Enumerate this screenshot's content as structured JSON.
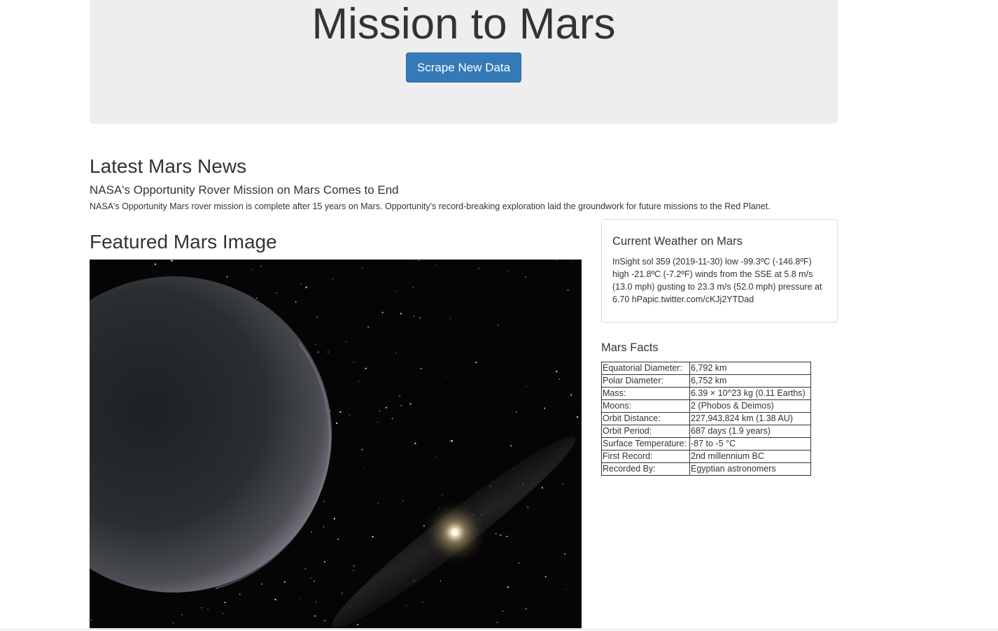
{
  "header": {
    "title": "Mission to Mars",
    "scrape_button_label": "Scrape New Data"
  },
  "news": {
    "section_title": "Latest Mars News",
    "headline": "NASA's Opportunity Rover Mission on Mars Comes to End",
    "teaser": "NASA's Opportunity Mars rover mission is complete after 15 years on Mars. Opportunity's record-breaking exploration laid the groundwork for future missions to the Red Planet."
  },
  "featured": {
    "section_title": "Featured Mars Image"
  },
  "weather": {
    "title": "Current Weather on Mars",
    "text": "InSight sol 359 (2019-11-30) low -99.3ºC (-146.8ºF) high -21.8ºC (-7.2ºF) winds from the SSE at 5.8 m/s (13.0 mph) gusting to 23.3 m/s (52.0 mph) pressure at 6.70 hPapic.twitter.com/cKJj2YTDad"
  },
  "facts": {
    "title": "Mars Facts",
    "rows": [
      {
        "label": "Equatorial Diameter:",
        "value": "6,792 km"
      },
      {
        "label": "Polar Diameter:",
        "value": "6,752 km"
      },
      {
        "label": "Mass:",
        "value": "6.39 × 10^23 kg (0.11 Earths)"
      },
      {
        "label": "Moons:",
        "value": "2 (Phobos & Deimos)"
      },
      {
        "label": "Orbit Distance:",
        "value": "227,943,824 km (1.38 AU)"
      },
      {
        "label": "Orbit Period:",
        "value": "687 days (1.9 years)"
      },
      {
        "label": "Surface Temperature:",
        "value": "-87 to -5 °C"
      },
      {
        "label": "First Record:",
        "value": "2nd millennium BC"
      },
      {
        "label": "Recorded By:",
        "value": "Egyptian astronomers"
      }
    ]
  }
}
